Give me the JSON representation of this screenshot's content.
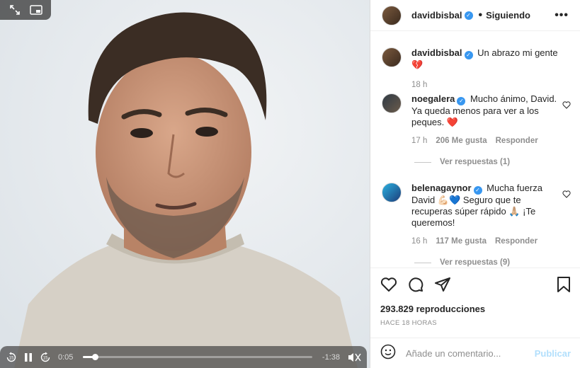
{
  "video": {
    "expand_icon": "expand-icon",
    "pip_icon": "picture-in-picture-icon",
    "controls": {
      "rewind_label": "15",
      "forward_label": "15",
      "current_time": "0:05",
      "remaining_time": "-1:38",
      "progress": 0.05
    }
  },
  "post": {
    "author": "davidbisbal",
    "separator": "•",
    "follow_status": "Siguiendo",
    "caption": "Un abrazo mi gente",
    "caption_emoji": "💔",
    "caption_time": "18 h",
    "comments": [
      {
        "user": "noegalera",
        "text": "Mucho ánimo, David. Ya queda menos para ver a los peques.",
        "emoji": "❤️",
        "time": "17 h",
        "likes": "206 Me gusta",
        "reply": "Responder",
        "view_replies": "Ver respuestas (1)"
      },
      {
        "user": "belenagaynor",
        "text_a": "Mucha fuerza David",
        "emoji_a": "💪🏻💙",
        "text_b": "Seguro que te recuperas súper rápido",
        "emoji_b": "🙏🏼",
        "text_c": "¡Te queremos!",
        "time": "16 h",
        "likes": "117 Me gusta",
        "reply": "Responder",
        "view_replies": "Ver respuestas (9)"
      }
    ],
    "views": "293.829 reproducciones",
    "posted_ago": "HACE 18 HORAS",
    "comment_placeholder": "Añade un comentario...",
    "publish_label": "Publicar"
  },
  "colors": {
    "verified": "#3897f0",
    "secondary_text": "#8e8e8e",
    "publish_disabled": "#b2dffc"
  }
}
